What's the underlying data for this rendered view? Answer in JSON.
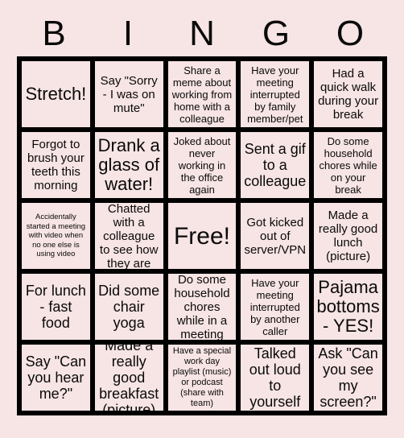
{
  "card": {
    "title": "BINGO",
    "background_color": "#f7e4e4",
    "cell_color": "#f7e4e4",
    "border_color": "#000000",
    "text_color": "#0a0a0a"
  },
  "header": {
    "letters": [
      "B",
      "I",
      "N",
      "G",
      "O"
    ]
  },
  "grid": {
    "rows": 5,
    "columns": 5,
    "cells": [
      {
        "text": "Stretch!",
        "size": "xl",
        "free": false
      },
      {
        "text": "Say \"Sorry - I was on mute\"",
        "size": "md",
        "free": false
      },
      {
        "text": "Share a meme about working from home with a colleague",
        "size": "sm",
        "free": false
      },
      {
        "text": "Have your meeting interrupted by family member/pet",
        "size": "sm",
        "free": false
      },
      {
        "text": "Had a quick walk during your break",
        "size": "md",
        "free": false
      },
      {
        "text": "Forgot to brush your teeth this morning",
        "size": "md",
        "free": false
      },
      {
        "text": "Drank a glass of water!",
        "size": "xl",
        "free": false
      },
      {
        "text": "Joked about never working in the office again",
        "size": "sm",
        "free": false
      },
      {
        "text": "Sent a gif to a colleague",
        "size": "lg",
        "free": false
      },
      {
        "text": "Do some household chores while on your break",
        "size": "sm",
        "free": false
      },
      {
        "text": "Accidentally started a meeting with video when no one else is using video",
        "size": "xxs",
        "free": false
      },
      {
        "text": "Chatted with a colleague to see how they are",
        "size": "md",
        "free": false
      },
      {
        "text": "Free!",
        "size": "xxl",
        "free": true
      },
      {
        "text": "Got kicked out of server/VPN",
        "size": "md",
        "free": false
      },
      {
        "text": "Made a really good lunch (picture)",
        "size": "md",
        "free": false
      },
      {
        "text": "For lunch - fast food",
        "size": "lg",
        "free": false
      },
      {
        "text": "Did some chair yoga",
        "size": "lg",
        "free": false
      },
      {
        "text": "Do some household chores while in a meeting",
        "size": "md",
        "free": false
      },
      {
        "text": "Have your meeting interrupted by another caller",
        "size": "sm",
        "free": false
      },
      {
        "text": "Pajama bottoms - YES!",
        "size": "xl",
        "free": false
      },
      {
        "text": "Say \"Can you hear me?\"",
        "size": "lg",
        "free": false
      },
      {
        "text": "Made a really good breakfast (picture)",
        "size": "lg",
        "free": false
      },
      {
        "text": "Have a special work day playlist (music) or podcast (share with team)",
        "size": "xs",
        "free": false
      },
      {
        "text": "Talked out loud to yourself",
        "size": "lg",
        "free": false
      },
      {
        "text": "Ask \"Can you see my screen?\"",
        "size": "lg",
        "free": false
      }
    ]
  }
}
